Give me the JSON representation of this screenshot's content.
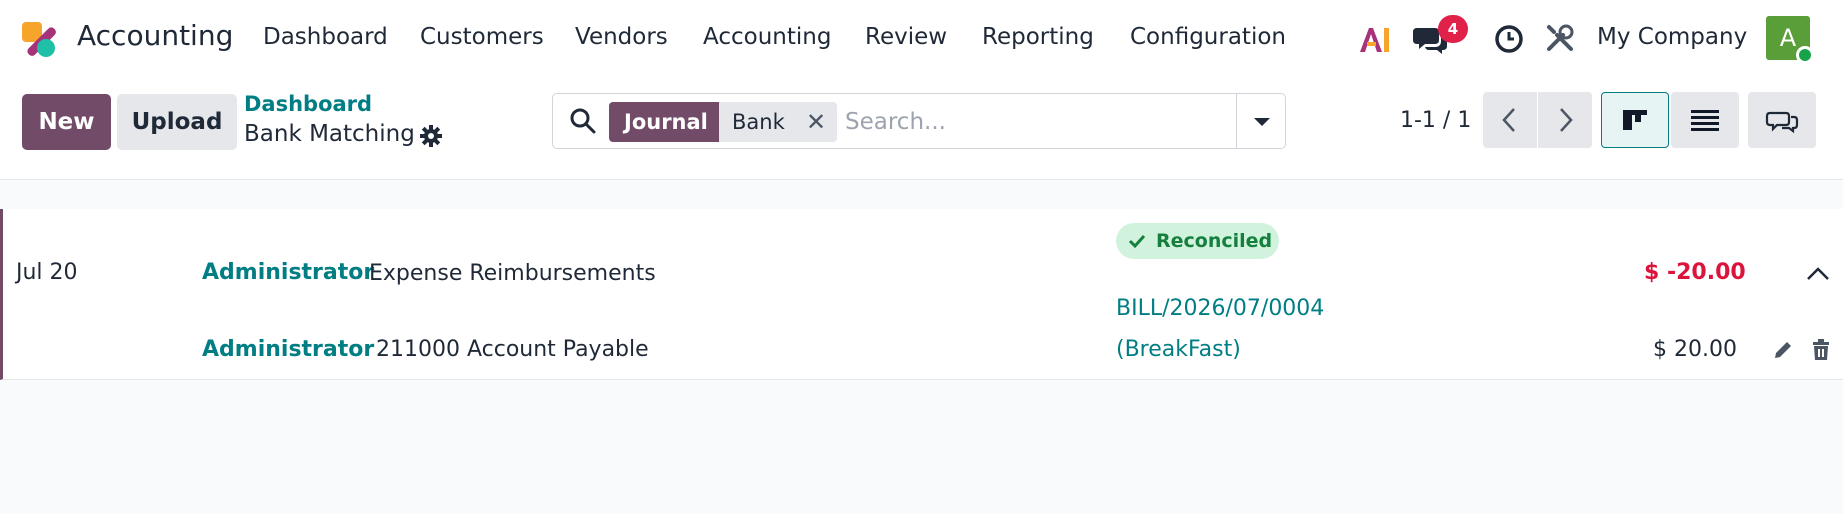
{
  "navbar": {
    "app_name": "Accounting",
    "menu": [
      "Dashboard",
      "Customers",
      "Vendors",
      "Accounting",
      "Review",
      "Reporting",
      "Configuration"
    ],
    "messages_count": "4",
    "company": "My Company",
    "avatar_initial": "A",
    "icons": [
      "ai-icon",
      "chat-icon",
      "clock-icon",
      "tools-icon"
    ]
  },
  "control_panel": {
    "new_label": "New",
    "upload_label": "Upload",
    "breadcrumb_parent": "Dashboard",
    "breadcrumb_current": "Bank Matching",
    "search": {
      "facet_label": "Journal",
      "facet_value": "Bank",
      "placeholder": "Search..."
    },
    "pager": "1-1 / 1"
  },
  "statement_line": {
    "date": "Jul 20",
    "partner": "Administrator",
    "label": "Expense Reimbursements",
    "status": "Reconciled",
    "amount": "$ -20.00",
    "counterpart": {
      "partner": "Administrator",
      "account": "211000 Account Payable",
      "reference_line1": "BILL/2026/07/0004",
      "reference_line2": "(BreakFast)",
      "amount": "$ 20.00"
    }
  },
  "colors": {
    "brand": "#714b67",
    "link": "#017e84",
    "negative": "#dc143c",
    "success_bg": "#d1f2dd",
    "success_text": "#15803d"
  }
}
